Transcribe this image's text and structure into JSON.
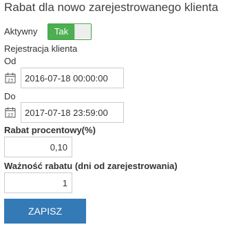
{
  "form": {
    "title": "Rabat dla nowo zarejestrowanego klienta",
    "active_label": "Aktywny",
    "active_toggle": {
      "on_label": "Tak",
      "state": "on"
    },
    "registration_label": "Rejestracja klienta",
    "from_label": "Od",
    "from_value": "2016-07-18 00:00:00",
    "to_label": "Do",
    "to_value": "2017-07-18 23:59:00",
    "percent_label": "Rabat procentowy(%)",
    "percent_value": "0,10",
    "validity_label": "Ważność rabatu (dni od zarejestrowania)",
    "validity_value": "1",
    "save_button": "ZAPISZ"
  },
  "colors": {
    "toggle_on": "#4caf50",
    "button": "#337ab7"
  },
  "icons": {
    "from_icon": "calendar-icon",
    "to_icon": "calendar-icon"
  }
}
